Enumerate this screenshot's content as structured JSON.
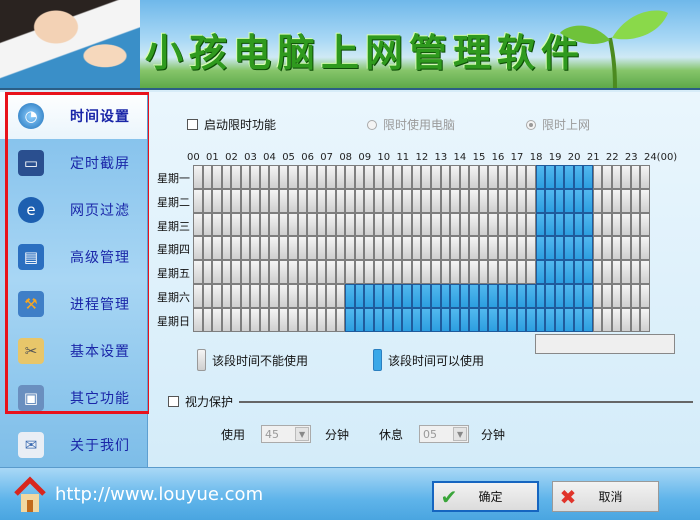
{
  "banner": {
    "title": "小孩电脑上网管理软件"
  },
  "sidebar": {
    "items": [
      {
        "label": "时间设置",
        "icon": "clock-globe-icon",
        "active": true
      },
      {
        "label": "定时截屏",
        "icon": "monitor-screenshot-icon"
      },
      {
        "label": "网页过滤",
        "icon": "ie-browser-icon"
      },
      {
        "label": "高级管理",
        "icon": "floppy-disk-icon"
      },
      {
        "label": "进程管理",
        "icon": "tools-icon"
      },
      {
        "label": "基本设置",
        "icon": "settings-tools-icon"
      },
      {
        "label": "其它功能",
        "icon": "computer-package-icon"
      },
      {
        "label": "关于我们",
        "icon": "contact-icon"
      }
    ]
  },
  "main": {
    "enable_label": "启动限时功能",
    "enable_checked": false,
    "radio_computer": "限时使用电脑",
    "radio_internet": "限时上网",
    "selected_mode": "限时上网",
    "hours": [
      "00",
      "01",
      "02",
      "03",
      "04",
      "05",
      "06",
      "07",
      "08",
      "09",
      "10",
      "11",
      "12",
      "13",
      "14",
      "15",
      "16",
      "17",
      "18",
      "19",
      "20",
      "21",
      "22",
      "23",
      "24(00)"
    ],
    "days": [
      "星期一",
      "星期二",
      "星期三",
      "星期四",
      "星期五",
      "星期六",
      "星期日"
    ],
    "schedule_allowed": {
      "星期一": [
        [
          "18:00",
          "21:00"
        ]
      ],
      "星期二": [
        [
          "18:00",
          "21:00"
        ]
      ],
      "星期三": [
        [
          "18:00",
          "21:00"
        ]
      ],
      "星期四": [
        [
          "18:00",
          "21:00"
        ]
      ],
      "星期五": [
        [
          "18:00",
          "21:00"
        ]
      ],
      "星期六": [
        [
          "08:00",
          "21:00"
        ]
      ],
      "星期日": [
        [
          "08:00",
          "21:00"
        ]
      ]
    },
    "legend_blocked": "该段时间不能使用",
    "legend_allowed": "该段时间可以使用",
    "eye_label": "视力保护",
    "eye_checked": false,
    "use_label": "使用",
    "use_value": "45",
    "rest_label": "休息",
    "rest_value": "05",
    "minute_label": "分钟"
  },
  "footer": {
    "url": "http://www.louyue.com",
    "ok": "确定",
    "cancel": "取消"
  },
  "colors": {
    "allowed": "#2c9ee0",
    "blocked": "#dcdcdc",
    "nav_text": "#1a26a8",
    "highlight": "#e8121b"
  }
}
